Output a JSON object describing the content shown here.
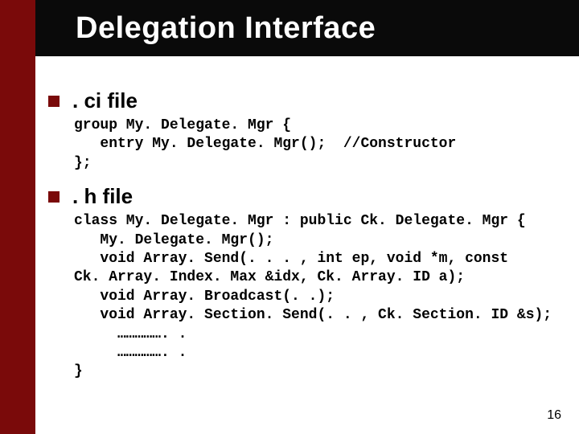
{
  "title": "Delegation Interface",
  "sections": [
    {
      "label": ". ci file",
      "code": "group My. Delegate. Mgr {\n   entry My. Delegate. Mgr();  //Constructor\n};"
    },
    {
      "label": ". h file",
      "code": "class My. Delegate. Mgr : public Ck. Delegate. Mgr {\n   My. Delegate. Mgr();\n   void Array. Send(. . . , int ep, void *m, const\nCk. Array. Index. Max &idx, Ck. Array. ID a);\n   void Array. Broadcast(. .);\n   void Array. Section. Send(. . , Ck. Section. ID &s);\n     ……………. .\n     ……………. .\n}"
    }
  ],
  "page_number": "16"
}
